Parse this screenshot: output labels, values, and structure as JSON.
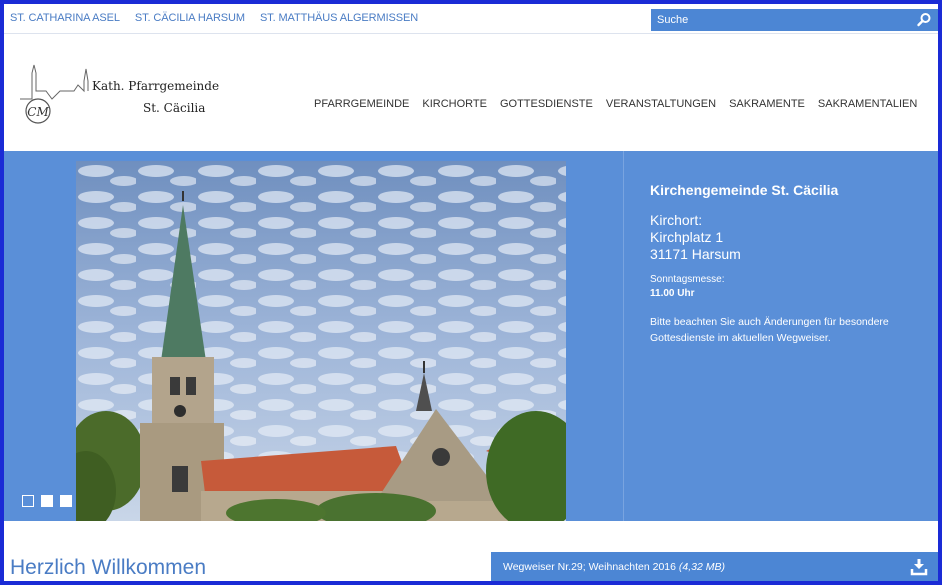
{
  "topbar": {
    "parish_links": [
      "ST. CATHARINA ASEL",
      "ST. CÄCILIA HARSUM",
      "ST. MATTHÄUS ALGERMISSEN"
    ],
    "search_placeholder": "Suche",
    "search_icon": "search-icon"
  },
  "header": {
    "logo_line1": "Kath. Pfarrgemeinde",
    "logo_line2": "St. Cäcilia",
    "logo_monogram": "CM",
    "nav": [
      "PFARRGEMEINDE",
      "KIRCHORTE",
      "GOTTESDIENSTE",
      "VERANSTALTUNGEN",
      "SAKRAMENTE",
      "SAKRAMENTALIEN"
    ]
  },
  "hero": {
    "title": "Kirchengemeinde St. Cäcilia",
    "place_label": "Kirchort:",
    "street": "Kirchplatz 1",
    "city": "31171 Harsum",
    "mass_label": "Sonntagsmesse:",
    "mass_time": "11.00 Uhr",
    "note": "Bitte beachten Sie auch Änderungen für besondere Gottesdienste im aktuellen Wegweiser.",
    "slides": 3,
    "active_slide": 1
  },
  "welcome": "Herzlich Willkommen",
  "download": {
    "label": "Wegweiser Nr.29; Weihnachten 2016",
    "size": "(4,32 MB)",
    "icon": "download-icon"
  },
  "colors": {
    "accent": "#4c86d4",
    "hero_bg": "#5a8fd8",
    "link": "#4a7cc4",
    "frame": "#1a2bd6"
  }
}
